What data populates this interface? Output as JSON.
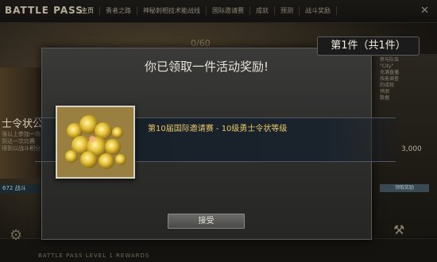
{
  "header": {
    "logo": "BATTLE PASS",
    "nav": [
      "主页",
      "勇者之路",
      "神秘刺相技术能战线",
      "国际邀请赛",
      "成就",
      "预测",
      "战斗奖励"
    ],
    "progress": "0/60"
  },
  "left": {
    "title": "士令状公",
    "subtitle": "强以上参加一场\n到达一次比赛\n得到以战斗积分",
    "level_badge": "672 战斗"
  },
  "right": {
    "lines": "参与队伍\n\"City\"\n充满直播\n技能调查\n的成就\n预测\n数据",
    "amount": "3,000",
    "button": "领取奖励"
  },
  "footer": {
    "bp_text": "BATTLE PASS   LEVEL 1 REWARDS"
  },
  "modal": {
    "title": "你已领取一件活动奖励!",
    "counter": "第1件（共1件）",
    "reward_label": "第10届国际邀请赛 - 10级勇士令状等级",
    "accept_label": "接受"
  },
  "colors": {
    "accent_gold": "#e8c96a",
    "modal_bg": "#2f2f2e"
  }
}
